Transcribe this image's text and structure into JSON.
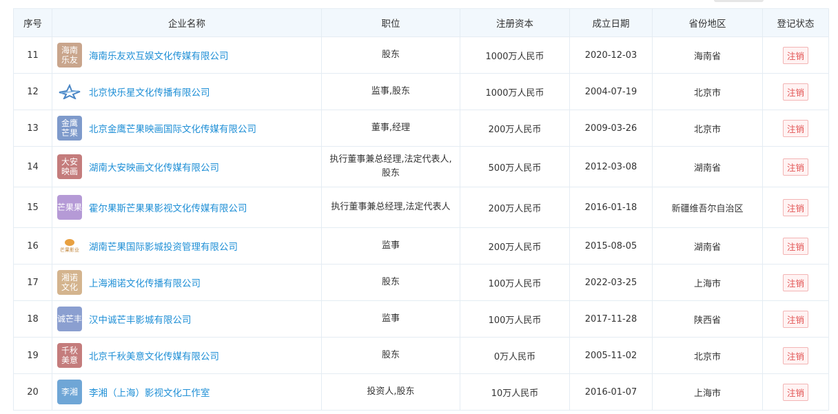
{
  "table": {
    "headers": [
      "序号",
      "企业名称",
      "职位",
      "注册资本",
      "成立日期",
      "省份地区",
      "登记状态"
    ],
    "rows": [
      {
        "index": "11",
        "logo_text": "海南乐友",
        "logo_color": "#c9a58c",
        "name": "海南乐友欢互娱文化传媒有限公司",
        "position": "股东",
        "capital": "1000万人民币",
        "date": "2020-12-03",
        "region": "海南省",
        "status": "注销"
      },
      {
        "index": "12",
        "logo_text": "",
        "logo_icon": "star-logo-icon",
        "logo_color": "#4a86c5",
        "name": "北京快乐星文化传播有限公司",
        "position": "监事,股东",
        "capital": "1000万人民币",
        "date": "2004-07-19",
        "region": "北京市",
        "status": "注销"
      },
      {
        "index": "13",
        "logo_text": "金鹰芒果",
        "logo_color": "#7e9acb",
        "name": "北京金鹰芒果映画国际文化传媒有限公司",
        "position": "董事,经理",
        "capital": "200万人民币",
        "date": "2009-03-26",
        "region": "北京市",
        "status": "注销"
      },
      {
        "index": "14",
        "logo_text": "大安映画",
        "logo_color": "#c47c7c",
        "name": "湖南大安映画文化传媒有限公司",
        "position": "执行董事兼总经理,法定代表人,股东",
        "capital": "500万人民币",
        "date": "2012-03-08",
        "region": "湖南省",
        "status": "注销"
      },
      {
        "index": "15",
        "logo_text": "芒果果",
        "logo_color": "#b59ad6",
        "name": "霍尔果斯芒果果影视文化传媒有限公司",
        "position": "执行董事兼总经理,法定代表人",
        "capital": "200万人民币",
        "date": "2016-01-18",
        "region": "新疆维吾尔自治区",
        "status": "注销"
      },
      {
        "index": "16",
        "logo_text": "芒果影业",
        "logo_icon": "mango-logo-icon",
        "logo_color": "#e8a040",
        "name": "湖南芒果国际影城投资管理有限公司",
        "position": "监事",
        "capital": "200万人民币",
        "date": "2015-08-05",
        "region": "湖南省",
        "status": "注销"
      },
      {
        "index": "17",
        "logo_text": "湘诺文化",
        "logo_color": "#d4b48e",
        "name": "上海湘诺文化传播有限公司",
        "position": "股东",
        "capital": "100万人民币",
        "date": "2022-03-25",
        "region": "上海市",
        "status": "注销"
      },
      {
        "index": "18",
        "logo_text": "诚芒丰",
        "logo_color": "#8b9fd0",
        "name": "汉中诚芒丰影城有限公司",
        "position": "监事",
        "capital": "100万人民币",
        "date": "2017-11-28",
        "region": "陕西省",
        "status": "注销"
      },
      {
        "index": "19",
        "logo_text": "千秋美意",
        "logo_color": "#c47c7c",
        "name": "北京千秋美意文化传媒有限公司",
        "position": "股东",
        "capital": "0万人民币",
        "date": "2005-11-02",
        "region": "北京市",
        "status": "注销"
      },
      {
        "index": "20",
        "logo_text": "李湘",
        "logo_color": "#6fa6d6",
        "name": "李湘（上海）影视文化工作室",
        "position": "投资人,股东",
        "capital": "10万人民币",
        "date": "2016-01-07",
        "region": "上海市",
        "status": "注销"
      }
    ]
  },
  "colors": {
    "link": "#1f8fd6",
    "header_bg": "#f2f8fd",
    "status_red": "#e25454"
  }
}
